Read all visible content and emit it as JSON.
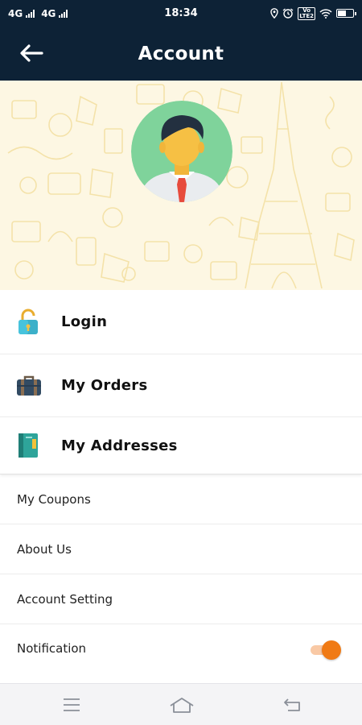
{
  "status_bar": {
    "network_1": "4G",
    "network_2": "4G",
    "time": "18:34",
    "volte_top": "Vo",
    "volte_bottom": "LTE2"
  },
  "app_bar": {
    "title": "Account",
    "back_icon": "arrow-left-icon"
  },
  "theme": {
    "header_bg": "#0d2236",
    "hero_bg": "#fdf7e3",
    "accent": "#f07a14"
  },
  "primary_menu": [
    {
      "label": "Login",
      "icon": "padlock-icon"
    },
    {
      "label": "My Orders",
      "icon": "briefcase-icon"
    },
    {
      "label": "My Addresses",
      "icon": "address-book-icon"
    }
  ],
  "secondary_menu": [
    {
      "label": "My Coupons"
    },
    {
      "label": "About Us"
    },
    {
      "label": "Account Setting"
    },
    {
      "label": "Notification",
      "toggle_on": true
    }
  ],
  "nav_bar": {
    "icons": [
      "menu-icon",
      "home-icon",
      "back-icon"
    ]
  }
}
